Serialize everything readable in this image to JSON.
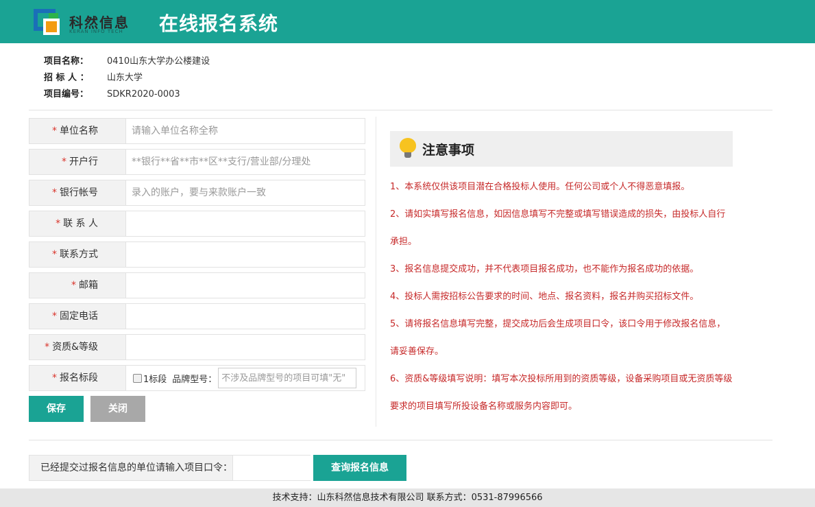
{
  "header": {
    "logo_text": "科然信息",
    "logo_sub": "KERAN INFO TECH",
    "title": "在线报名系统"
  },
  "project": {
    "name_label": "项目名称：",
    "name_value": "0410山东大学办公楼建设",
    "tenderer_label": "招 标 人 ：",
    "tenderer_value": "山东大学",
    "code_label": "项目编号：",
    "code_value": "SDKR2020-0003"
  },
  "form": {
    "required_mark": "*",
    "company": {
      "label": "单位名称",
      "placeholder": "请输入单位名称全称",
      "value": ""
    },
    "bank": {
      "label": "开户行",
      "placeholder": "**银行**省**市**区**支行/营业部/分理处",
      "value": ""
    },
    "account": {
      "label": "银行帐号",
      "placeholder": "录入的账户，要与来款账户一致",
      "value": ""
    },
    "contact": {
      "label": "联 系 人",
      "placeholder": "",
      "value": ""
    },
    "phone": {
      "label": "联系方式",
      "placeholder": "",
      "value": ""
    },
    "email": {
      "label": "邮箱",
      "placeholder": "",
      "value": ""
    },
    "landline": {
      "label": "固定电话",
      "placeholder": "",
      "value": ""
    },
    "qualification": {
      "label": "资质&等级",
      "placeholder": "",
      "value": ""
    },
    "lot": {
      "label": "报名标段",
      "option_label": "1标段",
      "checked": false,
      "brand_label": "品牌型号：",
      "brand_placeholder": "不涉及品牌型号的项目可填\"无\""
    },
    "save_label": "保存",
    "close_label": "关闭"
  },
  "notice": {
    "title": "注意事项",
    "items": [
      "1、本系统仅供该项目潜在合格投标人使用。任何公司或个人不得恶意填报。",
      "2、请如实填写报名信息，如因信息填写不完整或填写错误造成的损失，由投标人自行承担。",
      "3、报名信息提交成功，并不代表项目报名成功，也不能作为报名成功的依据。",
      "4、投标人需按招标公告要求的时间、地点、报名资料，报名并购买招标文件。",
      "5、请将报名信息填写完整，提交成功后会生成项目口令，该口令用于修改报名信息，请妥善保存。",
      "6、资质&等级填写说明：填写本次投标所用到的资质等级，设备采购项目或无资质等级要求的项目填写所投设备名称或服务内容即可。"
    ]
  },
  "query": {
    "label": "已经提交过报名信息的单位请输入项目口令：",
    "value": "",
    "button_label": "查询报名信息"
  },
  "footer": {
    "text": "技术支持：山东科然信息技术有限公司 联系方式：0531-87996566"
  },
  "colors": {
    "primary": "#1aa394",
    "notice_text": "#c62828",
    "required": "#d9342b",
    "close_button": "#a8a8a8"
  }
}
